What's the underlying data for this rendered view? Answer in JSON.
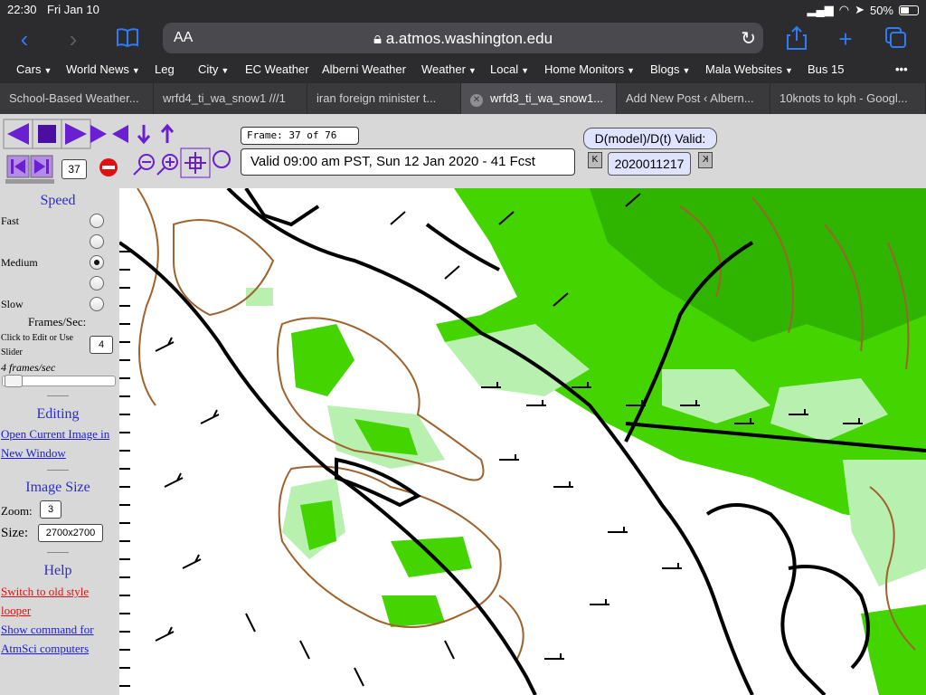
{
  "status": {
    "time": "22:30",
    "date": "Fri Jan 10",
    "battery": "50%"
  },
  "browser": {
    "text_size": "AA",
    "url": "a.atmos.washington.edu",
    "bookmarks": [
      {
        "label": "Cars",
        "menu": true
      },
      {
        "label": "World News",
        "menu": true
      },
      {
        "label": "Leg",
        "menu": false
      },
      {
        "label": "City",
        "menu": true
      },
      {
        "label": "EC Weather",
        "menu": false
      },
      {
        "label": "Alberni Weather",
        "menu": false
      },
      {
        "label": "Weather",
        "menu": true
      },
      {
        "label": "Local",
        "menu": true
      },
      {
        "label": "Home Monitors",
        "menu": true
      },
      {
        "label": "Blogs",
        "menu": true
      },
      {
        "label": "Mala Websites",
        "menu": true
      },
      {
        "label": "Bus 15",
        "menu": false
      },
      {
        "label": "•••",
        "menu": false
      }
    ],
    "tabs": [
      {
        "label": "School-Based Weather..."
      },
      {
        "label": "wrfd4_ti_wa_snow1 ///1"
      },
      {
        "label": "iran foreign minister t..."
      },
      {
        "label": "wrfd3_ti_wa_snow1..."
      },
      {
        "label": "Add New Post ‹ Albern..."
      },
      {
        "label": "10knots to kph - Googl..."
      }
    ]
  },
  "looper": {
    "frame_label": "Frame: 37 of 76",
    "frame_number": "37",
    "valid_text": "Valid 09:00 am PST, Sun 12 Jan 2020 - 41 Fcst",
    "dmodel_button": "D(model)/D(t) Valid:",
    "model_date": "2020011217",
    "prev_symbol": "K",
    "next_symbol": "K"
  },
  "sidebar": {
    "speed_heading": "Speed",
    "fast": "Fast",
    "medium": "Medium",
    "slow": "Slow",
    "fps_heading": "Frames/Sec:",
    "fps_hint": "Click to Edit or Use Slider",
    "fps_value": "4",
    "fps_display": "4 frames/sec",
    "editing_heading": "Editing",
    "open_image_link": "Open Current Image in New Window",
    "image_size_heading": "Image Size",
    "zoom_label": "Zoom:",
    "zoom_value": "3",
    "size_label": "Size:",
    "size_value": "2700x2700",
    "help_heading": "Help",
    "old_style_link": "Switch to old style looper",
    "command_link": "Show command for AtmSci computers"
  },
  "colors": {
    "accent": "#2f7cf6",
    "control_purple": "#6a1fd0",
    "map_green": "#44d400",
    "map_light_green": "#b8f0b0",
    "contour_brown": "#a0622d"
  }
}
